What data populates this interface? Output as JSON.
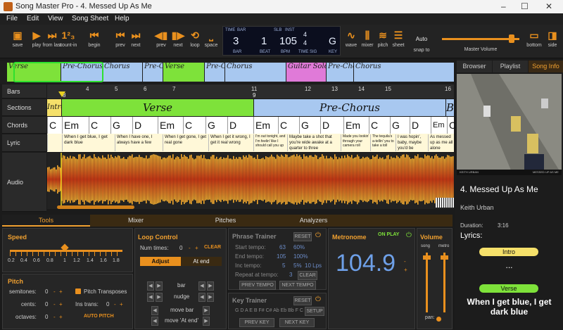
{
  "window": {
    "title": "Song Master Pro - 4. Messed Up As Me",
    "minimize": "–",
    "maximize": "☐",
    "close": "✕"
  },
  "menu": [
    "File",
    "Edit",
    "View",
    "Song Sheet",
    "Help"
  ],
  "toolbar": {
    "save": "save",
    "play": "play",
    "from_last": "from last",
    "count_in": "count-in",
    "begin": "begin",
    "prev1": "prev",
    "next1": "next",
    "prev2": "prev",
    "next2": "next",
    "loop": "loop",
    "space": "space",
    "wave": "wave",
    "mixer": "mixer",
    "pitch": "pitch",
    "sheet": "sheet",
    "snap_to": "snap to",
    "snap_val": "Auto",
    "master_volume": "Master Volume",
    "bottom": "bottom",
    "side": "side",
    "master_volume_level": 0.9
  },
  "lcd": {
    "time_lbl": "TIME",
    "bar_tab": "BAR",
    "slb_lbl": "SLB",
    "inst_lbl": "INST",
    "bar": "3",
    "beat": "1",
    "bpm": "105",
    "timesig_top": "4",
    "timesig_bottom": "4",
    "key": "G",
    "bar_lbl": "BAR",
    "beat_lbl": "BEAT",
    "bpm_lbl": "BPM",
    "timesig_lbl": "TIME SIG",
    "key_lbl": "KEY"
  },
  "overview": [
    "Verse",
    "Pre-Chorus",
    "Chorus",
    "Pre-Chorus",
    "Verse",
    "Pre-Chorus",
    "Chorus",
    "Guitar Solo",
    "Pre-Chorus",
    "Chorus"
  ],
  "tracks": {
    "bars": "Bars",
    "sections": "Sections",
    "chords": "Chords",
    "lyric": "Lyric",
    "audio": "Audio"
  },
  "ruler": [
    "4",
    "5",
    "6",
    "7",
    "8",
    "9",
    "10",
    "11",
    "12",
    "13",
    "14",
    "15",
    "16"
  ],
  "sections": [
    {
      "name": "Intro",
      "color": "#f5e06a"
    },
    {
      "name": "Verse",
      "color": "#7ee23a"
    },
    {
      "name": "Pre-Chorus",
      "color": "#a8c8f0"
    },
    {
      "name": "B",
      "color": "#a8c8f0"
    }
  ],
  "ruler_mark": "8",
  "chords": [
    "C",
    "Em",
    "C",
    "G",
    "D",
    "Em",
    "C",
    "G",
    "D",
    "Em",
    "C",
    "G",
    "D",
    "Em",
    "C",
    "G",
    "D",
    "Em",
    "C"
  ],
  "lyrics": [
    "",
    "When I get blue, I get dark blue",
    "When I have one, I always have a few",
    "When I get gone, I get real gone",
    "When I get it wrong, I get it real wrong",
    "I'm out tonight, and I'm feelin' like I should call you up",
    "Maybe take a shot that you're wide awake at a quarter to three",
    "Made you lookin' through your camera roll",
    "The tequila's a-tellin' you to take a toll",
    "I was hopin', baby, maybe you'd be",
    "As messed up as me all alone"
  ],
  "right": {
    "tabs": [
      "Browser",
      "Playlist",
      "Song Info"
    ],
    "song_title": "4. Messed Up As Me",
    "artist": "Keith Urban",
    "duration_lbl": "Duration:",
    "duration": "3:16",
    "lyrics_lbl": "Lyrics:",
    "intro": "Intro",
    "dots": "...",
    "verse": "Verse",
    "first_line": "When I get blue, I get dark blue",
    "video_left": "KEITH URBAN",
    "video_right": "MESSED UP AS ME"
  },
  "bottom_tabs": [
    "Tools",
    "Mixer",
    "Pitches",
    "Analyzers"
  ],
  "speed": {
    "title": "Speed",
    "ticks": [
      "0.2",
      "0.4",
      "0.6",
      "0.8",
      "1",
      "1.2",
      "1.4",
      "1.6",
      "1.8"
    ]
  },
  "pitch": {
    "title": "Pitch",
    "semitones": "semitones:",
    "cents": "cents:",
    "octaves": "octaves:",
    "val": "0",
    "minus": "-",
    "plus": "+",
    "transposes": "Pitch Transposes",
    "ins_trans": "Ins trans:",
    "auto": "AUTO PITCH"
  },
  "loop": {
    "title": "Loop Control",
    "num_times": "Num times:",
    "num": "0",
    "clear": "CLEAR",
    "adjust": "Adjust",
    "at_end": "At end",
    "bar": "bar",
    "nudge": "nudge",
    "move_bar": "move bar",
    "move_at_end": "move 'At end'"
  },
  "phrase": {
    "title": "Phrase Trainer",
    "reset": "RESET",
    "start": "Start tempo:",
    "start_v": "63",
    "start_p": "60%",
    "end": "End tempo:",
    "end_v": "105",
    "end_p": "100%",
    "inc": "Inc tempo:",
    "inc_v": "5",
    "inc_p": "5%",
    "inc_l": "10 Lps",
    "repeat": "Repeat at tempo:",
    "repeat_v": "3",
    "clear": "CLEAR",
    "prev": "PREV TEMPO",
    "next": "NEXT TEMPO"
  },
  "key": {
    "title": "Key Trainer",
    "reset": "RESET",
    "keys": "G D A E B F# C# Ab Eb Bb F C",
    "setup": "SETUP",
    "prev": "PREV KEY",
    "next": "NEXT KEY"
  },
  "metronome": {
    "title": "Metronome",
    "on_play": "ON PLAY",
    "bpm": "104.9"
  },
  "volume": {
    "title": "Volume",
    "song": "song",
    "metro": "metro",
    "pan": "pan:"
  }
}
